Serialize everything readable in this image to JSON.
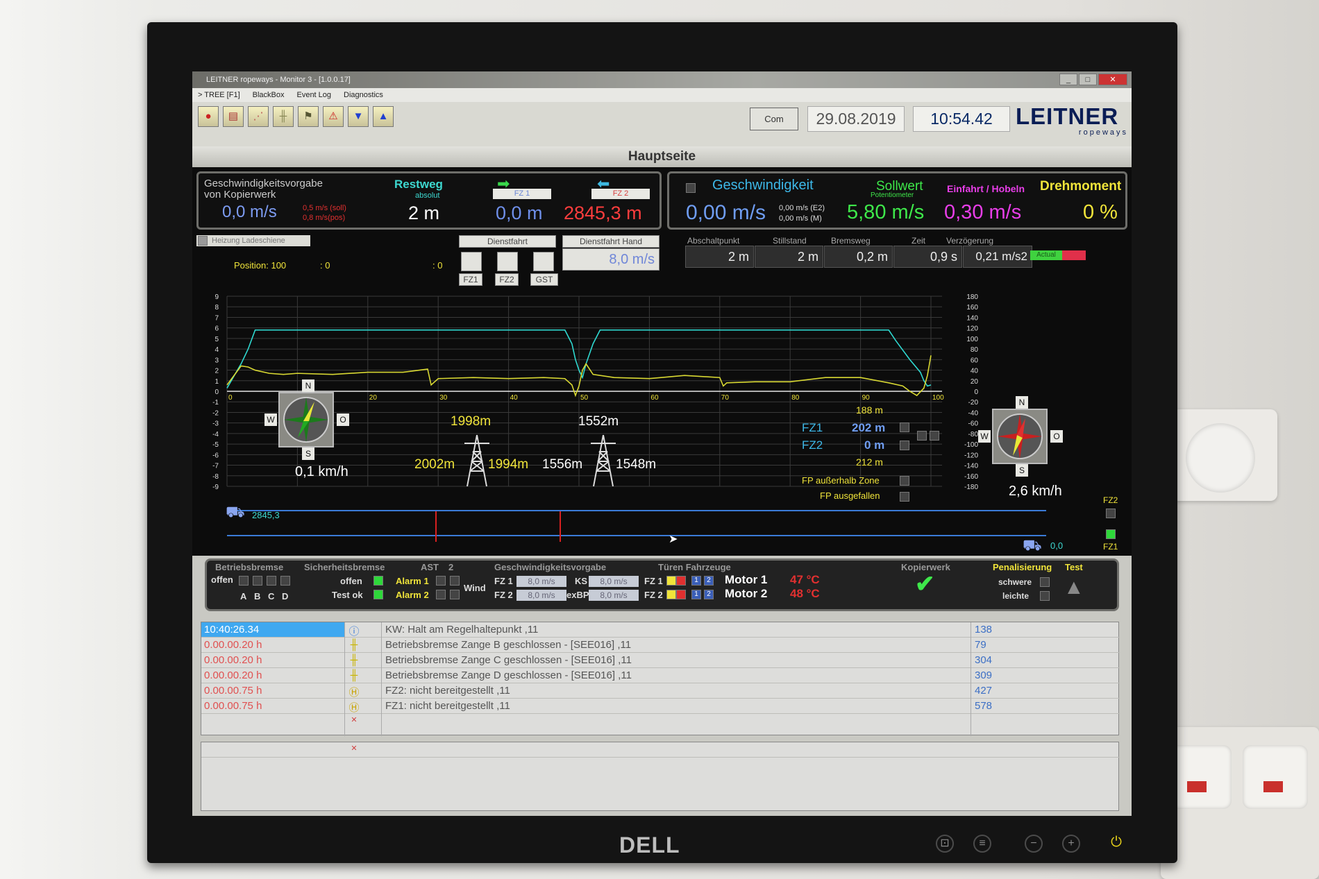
{
  "window": {
    "title": "LEITNER ropeways - Monitor 3 - [1.0.0.17]",
    "menu": [
      "> TREE [F1]",
      "BlackBox",
      "Event Log",
      "Diagnostics"
    ],
    "close_glyph": "✕"
  },
  "toolbar": {
    "icons": [
      "overview-icon",
      "chart-icon",
      "trend-icon",
      "brake-icon",
      "test-icon",
      "warning-icon",
      "arrow-down-icon",
      "arrow-up-icon"
    ],
    "com_label": "Com",
    "date": "29.08.2019",
    "time": "10:54.42",
    "logo_main": "LEITNER",
    "logo_sub": "ropeways"
  },
  "page_title": "Hauptseite",
  "left_panel": {
    "label_line1": "Geschwindigkeitsvorgabe",
    "label_line2": "von Kopierwerk",
    "speed_value": "0,0 m/s",
    "soll_text": "0,5 m/s (soll)",
    "pos_text": "0,8 m/s(pos)",
    "restweg_label": "Restweg",
    "absolut_label": "absolut",
    "restweg_value": "2 m",
    "fz1_label": "FZ 1",
    "fz2_label": "FZ 2",
    "fz1_value": "0,0 m",
    "fz2_value": "2845,3 m",
    "heizung_label": "Heizung Ladeschiene"
  },
  "right_panel": {
    "geschwindigkeit_label": "Geschwindigkeit",
    "geschwindigkeit_value": "0,00 m/s",
    "e2_text": "0,00 m/s (E2)",
    "m_text": "0,00 m/s (M)",
    "sollwert_label": "Sollwert",
    "potentiometer_label": "Potentiometer",
    "sollwert_value": "5,80 m/s",
    "einfahrt_label": "Einfahrt / Hobeln",
    "einfahrt_value": "0,30 m/s",
    "drehmoment_label": "Drehmoment",
    "drehmoment_value": "0 %"
  },
  "dienstfahrt": {
    "label": "Dienstfahrt",
    "buttons": [
      "FZ1",
      "FZ2",
      "GST"
    ],
    "hand_label": "Dienstfahrt Hand",
    "hand_value": "8,0 m/s"
  },
  "params": [
    {
      "label": "Abschaltpunkt",
      "value": "2 m"
    },
    {
      "label": "Stillstand",
      "value": "2 m"
    },
    {
      "label": "Bremsweg",
      "value": "0,2 m"
    },
    {
      "label": "Zeit",
      "value": "0,9 s"
    },
    {
      "label": "Verzögerung",
      "value": "0,21 m/s2"
    }
  ],
  "actual_label": "Actual",
  "position_label": "Position: 100",
  "position_colon_a": ": 0",
  "position_colon_b": ": 0",
  "chart_data": {
    "type": "line",
    "x_ticks": [
      0,
      10,
      20,
      30,
      40,
      50,
      60,
      70,
      80,
      90,
      100
    ],
    "y_left_ticks": [
      9,
      8,
      7,
      6,
      5,
      4,
      3,
      2,
      1,
      0,
      -1,
      -2,
      -3,
      -4,
      -5,
      -6,
      -7,
      -8,
      -9
    ],
    "y_right_ticks": [
      180,
      160,
      140,
      120,
      100,
      80,
      60,
      40,
      20,
      0,
      -20,
      -40,
      -60,
      -80,
      -100,
      -120,
      -140,
      -160,
      -180
    ],
    "xlim": [
      0,
      100
    ],
    "ylim": [
      -9,
      9
    ],
    "grid": true,
    "series": [
      {
        "color": "#2fd8d0",
        "x": [
          0,
          2,
          3,
          4,
          48,
          49,
          49.5,
          50,
          50.5,
          51,
          52,
          53,
          94,
          95,
          97,
          98.5,
          99,
          99.5,
          100
        ],
        "y": [
          0.3,
          2.6,
          4,
          5.8,
          5.8,
          4.5,
          3,
          2,
          1.3,
          2.6,
          4.5,
          5.8,
          5.8,
          4.8,
          3,
          1.8,
          1,
          0.5,
          0.6
        ]
      },
      {
        "color": "#d8d832",
        "x": [
          0,
          2,
          3,
          4,
          6,
          8,
          10,
          15,
          20,
          25,
          28.5,
          29,
          30,
          35,
          40,
          45,
          48,
          49,
          49.5,
          50,
          50.5,
          51,
          52,
          55,
          60,
          65,
          70,
          70.5,
          71,
          75,
          80,
          85,
          90,
          94,
          96,
          97,
          98,
          99,
          99.5,
          100
        ],
        "y": [
          0.6,
          2.4,
          2.3,
          2.0,
          1.7,
          1.6,
          1.7,
          1.6,
          1.8,
          1.8,
          2.1,
          0.6,
          1.2,
          1.3,
          1.2,
          1.3,
          1.2,
          0.6,
          -0.4,
          0.5,
          2.0,
          2.6,
          1.6,
          1.3,
          1.2,
          1.5,
          1.3,
          0.5,
          0.8,
          0.9,
          0.9,
          1.3,
          1.3,
          0.8,
          0.5,
          0,
          -0.4,
          0.3,
          1.5,
          3.4
        ]
      }
    ]
  },
  "compass_left": {
    "n": "N",
    "s": "S",
    "w": "W",
    "o": "O",
    "speed": "0,1 km/h"
  },
  "compass_right": {
    "n": "N",
    "s": "S",
    "w": "W",
    "o": "O",
    "speed": "2,6 km/h"
  },
  "towers": [
    {
      "top": "1998m",
      "left": "2002m",
      "right": "1994m"
    },
    {
      "top": "1552m",
      "left": "1556m",
      "right": "1548m"
    }
  ],
  "fz_info": {
    "top_m": "188 m",
    "fz1_label": "FZ1",
    "fz1_value": "202 m",
    "fz2_label": "FZ2",
    "fz2_value": "0 m",
    "bottom_m": "212 m",
    "fp_zone": "FP außerhalb Zone",
    "fp_fail": "FP ausgefallen"
  },
  "track": {
    "left_label": "2845,3",
    "right_label": "0,0",
    "fz2": "FZ2",
    "fz1": "FZ1",
    "car_glyph": "⛟"
  },
  "status": {
    "betriebsbremse": "Betriebsbremse",
    "offen_left": "offen",
    "abcd": [
      "A",
      "B",
      "C",
      "D"
    ],
    "sicherheitsbremse": "Sicherheitsbremse",
    "offen": "offen",
    "test_ok": "Test ok",
    "ast": "AST",
    "ast2": "2",
    "alarm1": "Alarm 1",
    "alarm2": "Alarm 2",
    "wind": "Wind",
    "gv_label": "Geschwindigkeitsvorgabe",
    "fz1": "FZ 1",
    "fz2": "FZ 2",
    "fz1_val": "8,0 m/s",
    "fz2_val": "8,0 m/s",
    "ks": "KS",
    "exbp": "exBP",
    "ks_val": "8,0 m/s",
    "exbp_val": "8,0 m/s",
    "turen": "Türen Fahrzeuge",
    "tfz1": "FZ 1",
    "tfz2": "FZ 2",
    "door_nums": [
      "1",
      "2"
    ],
    "motor1": "Motor 1",
    "motor2": "Motor 2",
    "motor1_temp": "47 °C",
    "motor2_temp": "48 °C",
    "kopierwerk": "Kopierwerk",
    "check_glyph": "✔",
    "penalisierung": "Penalisierung",
    "test": "Test",
    "schwere": "schwere",
    "leichte": "leichte"
  },
  "log": [
    {
      "time": "10:40:26.34",
      "icon": "info-icon",
      "glyph": "ⓘ",
      "text": "KW: Halt am Regelhaltepunkt ,11",
      "num": "138",
      "selected": true
    },
    {
      "time": "0.00.00.20  h",
      "icon": "brake-icon",
      "glyph": "╫",
      "text": "Betriebsbremse Zange B geschlossen - [SEE016]  ,11",
      "num": "79"
    },
    {
      "time": "0.00.00.20  h",
      "icon": "brake-icon",
      "glyph": "╫",
      "text": "Betriebsbremse Zange C geschlossen - [SEE016]  ,11",
      "num": "304"
    },
    {
      "time": "0.00.00.20  h",
      "icon": "brake-icon",
      "glyph": "╫",
      "text": "Betriebsbremse Zange D geschlossen - [SEE016]  ,11",
      "num": "309"
    },
    {
      "time": "0.00.00.75  h",
      "icon": "hold-icon",
      "glyph": "Ⓗ",
      "text": "FZ2: nicht bereitgestellt ,11",
      "num": "427"
    },
    {
      "time": "0.00.00.75  h",
      "icon": "hold-icon",
      "glyph": "Ⓗ",
      "text": "FZ1: nicht bereitgestellt ,11",
      "num": "578"
    }
  ],
  "empty_glyph": "✕",
  "monitor": {
    "brand": "DELL",
    "power_glyph": "⏻"
  }
}
